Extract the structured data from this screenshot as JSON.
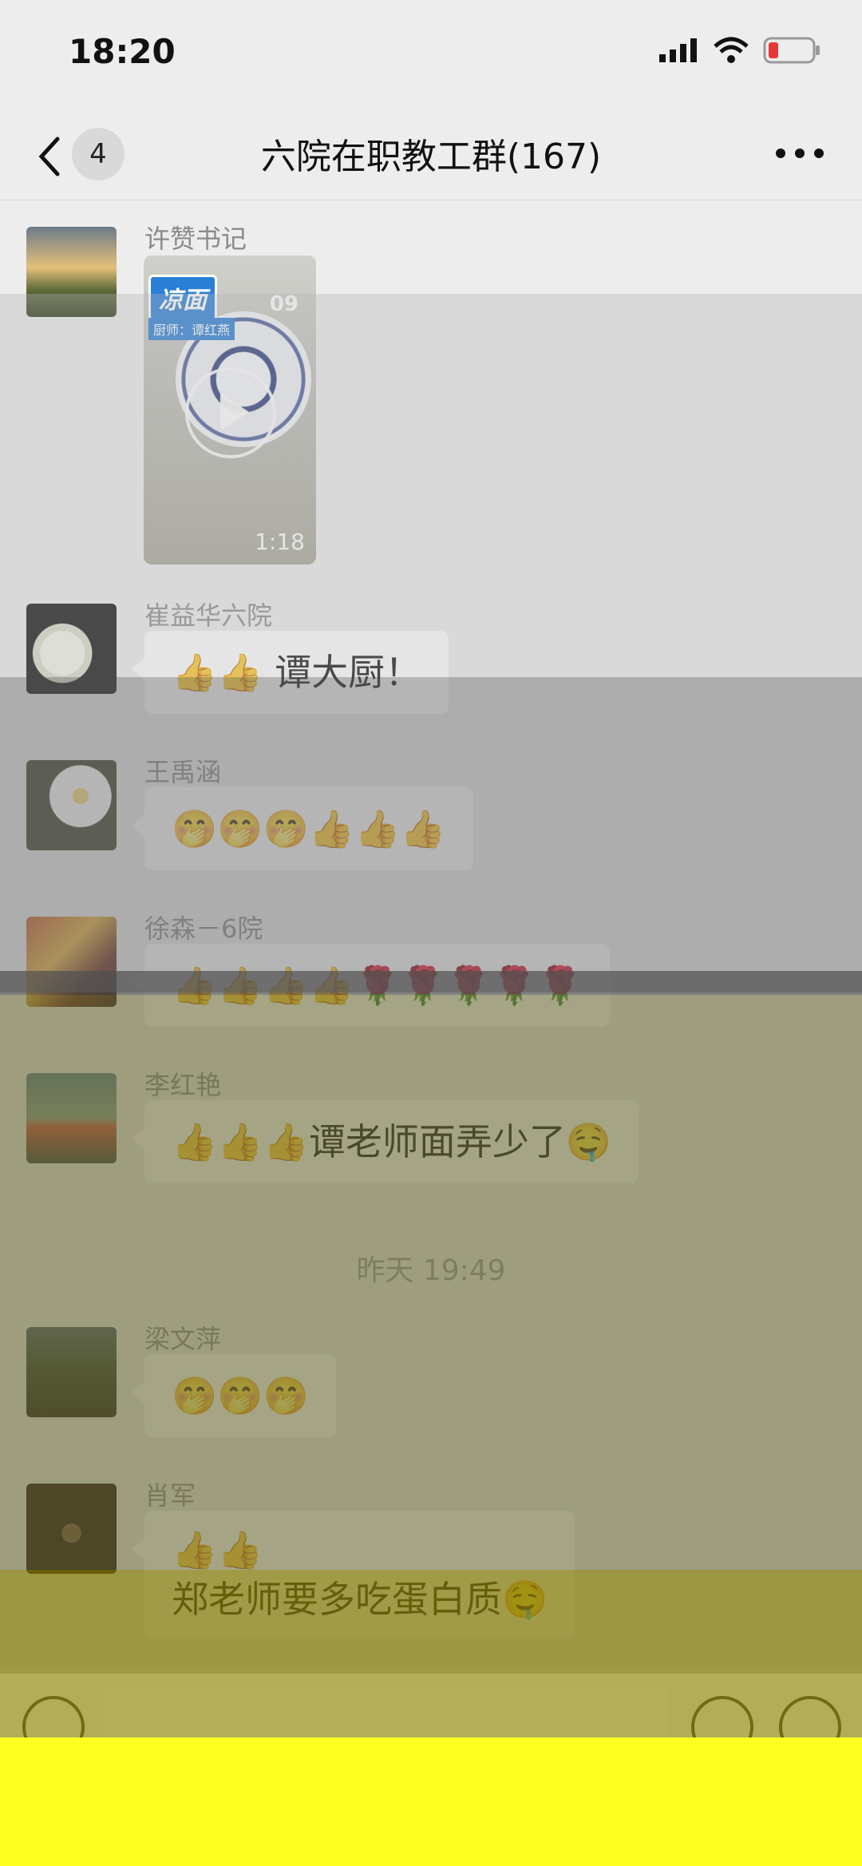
{
  "status": {
    "time": "18:20"
  },
  "header": {
    "back_count": "4",
    "title": "六院在职教工群(167)"
  },
  "messages": [
    {
      "sender": "许赞书记",
      "type": "video",
      "video": {
        "tag": "凉面",
        "subtag": "厨师：谭红燕",
        "date": "09",
        "duration": "1:18"
      }
    },
    {
      "sender": "崔益华六院",
      "text": "👍👍 谭大厨！"
    },
    {
      "sender": "王禹涵",
      "text": "🤭🤭🤭👍👍👍"
    },
    {
      "sender": "徐森－6院",
      "text": "👍👍👍👍🌹🌹🌹🌹🌹"
    },
    {
      "sender": "李红艳",
      "text": "👍👍👍谭老师面弄少了🤤"
    },
    {
      "sender": "梁文萍",
      "text": "🤭🤭🤭"
    },
    {
      "sender": "肖军",
      "text_line1": "👍👍",
      "text_line2": "郑老师要多吃蛋白质🤤"
    }
  ],
  "divider": {
    "time": "昨天 19:49"
  },
  "icons": {
    "back": "chevron-left-icon",
    "more": "more-dots-icon",
    "voice": "voice-icon",
    "emoji": "emoji-icon",
    "add": "add-icon",
    "signal": "signal-icon",
    "wifi": "wifi-icon",
    "battery": "battery-icon",
    "play": "play-icon"
  },
  "colors": {
    "overlay_gray": "#9f9f9f",
    "overlay_olive": "#7a7a3a",
    "overlay_yellow": "#ffff22",
    "bubble": "#ffffff"
  }
}
